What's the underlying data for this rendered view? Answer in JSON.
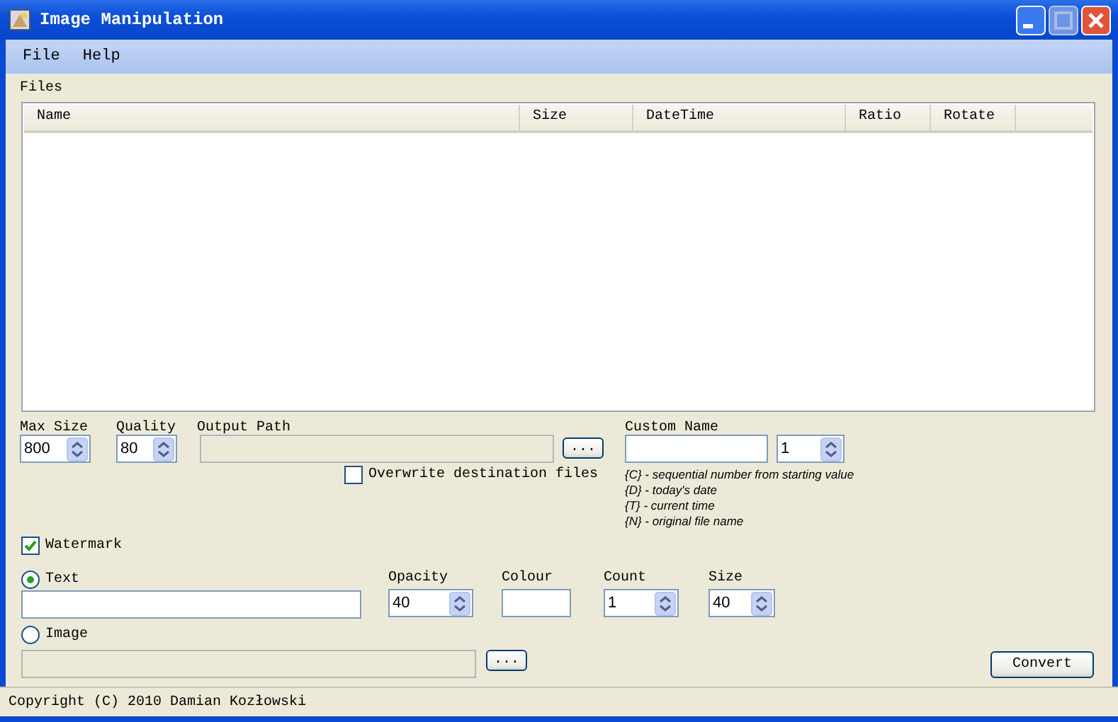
{
  "window": {
    "title": "Image Manipulation"
  },
  "menu": [
    {
      "label": "File"
    },
    {
      "label": "Help"
    }
  ],
  "files": {
    "label": "Files",
    "columns": [
      "Name",
      "Size",
      "DateTime",
      "Ratio",
      "Rotate"
    ]
  },
  "max_size": {
    "label": "Max Size",
    "value": "800"
  },
  "quality": {
    "label": "Quality",
    "value": "80"
  },
  "output_path": {
    "label": "Output Path",
    "button": "..."
  },
  "overwrite": {
    "label": "Overwrite destination files",
    "checked": false
  },
  "custom_name": {
    "label": "Custom Name",
    "start": "1",
    "hints": [
      "{C} - sequential number from starting value",
      "{D} - today's date",
      "{T} - current time",
      "{N} - original file name"
    ]
  },
  "watermark": {
    "label": "Watermark",
    "checked": true,
    "options": [
      {
        "label": "Text",
        "selected": true
      },
      {
        "label": "Image",
        "selected": false
      }
    ],
    "opacity": {
      "label": "Opacity",
      "value": "40"
    },
    "colour": {
      "label": "Colour"
    },
    "count": {
      "label": "Count",
      "value": "1"
    },
    "size": {
      "label": "Size",
      "value": "40"
    },
    "image_button": "..."
  },
  "convert_button": "Convert",
  "status_bar": "Copyright (C) 2010 Damian Kozłowski"
}
